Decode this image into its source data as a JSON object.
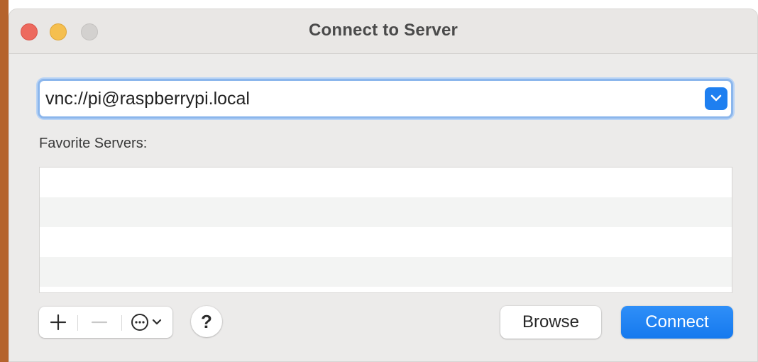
{
  "window": {
    "title": "Connect to Server"
  },
  "server": {
    "address": "vnc://pi@raspberrypi.local",
    "dropdown_icon": "chevron-down-icon"
  },
  "favorites": {
    "label": "Favorite Servers:",
    "items": []
  },
  "toolbar": {
    "add_icon": "plus-icon",
    "remove_icon": "minus-icon",
    "more_icon": "ellipsis-circle-icon",
    "help_label": "?"
  },
  "buttons": {
    "browse_label": "Browse",
    "connect_label": "Connect"
  },
  "colors": {
    "accent": "#1a82f5",
    "close": "#ed6a5e",
    "minimize": "#f5bf4f",
    "zoom_disabled": "#d3d1cf"
  }
}
